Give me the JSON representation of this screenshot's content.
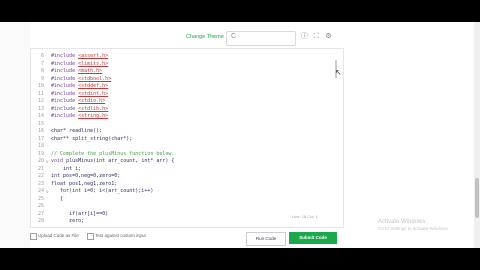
{
  "toolbar": {
    "change_theme": "Change Theme",
    "language_selector": "C",
    "icons": [
      "info-icon",
      "expand-icon",
      "settings-icon"
    ]
  },
  "editor": {
    "lines": [
      {
        "n": "6",
        "parts": [
          {
            "t": "kw",
            "v": "#include "
          },
          {
            "t": "hdr",
            "v": "<assert.h>"
          }
        ]
      },
      {
        "n": "7",
        "parts": [
          {
            "t": "kw",
            "v": "#include "
          },
          {
            "t": "hdr",
            "v": "<limits.h>"
          }
        ]
      },
      {
        "n": "8",
        "parts": [
          {
            "t": "kw",
            "v": "#include "
          },
          {
            "t": "hdr",
            "v": "<math.h>"
          }
        ]
      },
      {
        "n": "9",
        "parts": [
          {
            "t": "kw",
            "v": "#include "
          },
          {
            "t": "hdr",
            "v": "<stdbool.h>"
          }
        ]
      },
      {
        "n": "10",
        "parts": [
          {
            "t": "kw",
            "v": "#include "
          },
          {
            "t": "hdr",
            "v": "<stddef.h>"
          }
        ]
      },
      {
        "n": "11",
        "parts": [
          {
            "t": "kw",
            "v": "#include "
          },
          {
            "t": "hdr",
            "v": "<stdint.h>"
          }
        ]
      },
      {
        "n": "12",
        "parts": [
          {
            "t": "kw",
            "v": "#include "
          },
          {
            "t": "hdr",
            "v": "<stdio.h>"
          }
        ]
      },
      {
        "n": "13",
        "parts": [
          {
            "t": "kw",
            "v": "#include "
          },
          {
            "t": "hdr",
            "v": "<stdlib.h>"
          }
        ]
      },
      {
        "n": "14",
        "parts": [
          {
            "t": "kw",
            "v": "#include "
          },
          {
            "t": "hdr",
            "v": "<string.h>"
          }
        ]
      },
      {
        "n": "15",
        "parts": []
      },
      {
        "n": "16",
        "parts": [
          {
            "t": "tx",
            "v": "char* readline();"
          }
        ]
      },
      {
        "n": "17",
        "parts": [
          {
            "t": "tx",
            "v": "char** split_string(char*);"
          }
        ]
      },
      {
        "n": "18",
        "parts": []
      },
      {
        "n": "19",
        "parts": [
          {
            "t": "cmt",
            "v": "// Complete the plusMinus function below."
          }
        ]
      },
      {
        "n": "20",
        "fold": "v",
        "parts": [
          {
            "t": "kw",
            "v": "void "
          },
          {
            "t": "tx",
            "v": "plusMinus(int arr_count, int* arr) {"
          }
        ]
      },
      {
        "n": "21",
        "parts": [
          {
            "t": "tx",
            "v": "    int i;"
          }
        ]
      },
      {
        "n": "22",
        "parts": [
          {
            "t": "tx",
            "v": "int pos=0,neg=0,zero=0;"
          }
        ]
      },
      {
        "n": "23",
        "parts": [
          {
            "t": "tx",
            "v": "float pos1,neg1,zero1;"
          }
        ]
      },
      {
        "n": "24",
        "fold": "v",
        "parts": [
          {
            "t": "tx",
            "v": "   for(int i=0; i<(arr_count);i++)"
          }
        ]
      },
      {
        "n": "25",
        "parts": [
          {
            "t": "tx",
            "v": "   {"
          }
        ]
      },
      {
        "n": "26",
        "parts": []
      },
      {
        "n": "27",
        "parts": [
          {
            "t": "tx",
            "v": "      if(arr[i]==0)"
          }
        ]
      },
      {
        "n": "28",
        "parts": [
          {
            "t": "tx",
            "v": "      zero;"
          }
        ]
      }
    ],
    "status": "Line: 18 Col: 1"
  },
  "footer": {
    "upload_label": "Upload Code as File",
    "custom_input_label": "Test against custom input",
    "run_label": "Run Code",
    "submit_label": "Submit Code"
  },
  "watermark": {
    "title": "Activate Windows",
    "subtitle": "Go to Settings to activate Windows."
  },
  "colors": {
    "accent": "#1ba94c",
    "keyword": "#7a3e9d",
    "header": "#c43a3a",
    "comment": "#4a9b4a"
  }
}
